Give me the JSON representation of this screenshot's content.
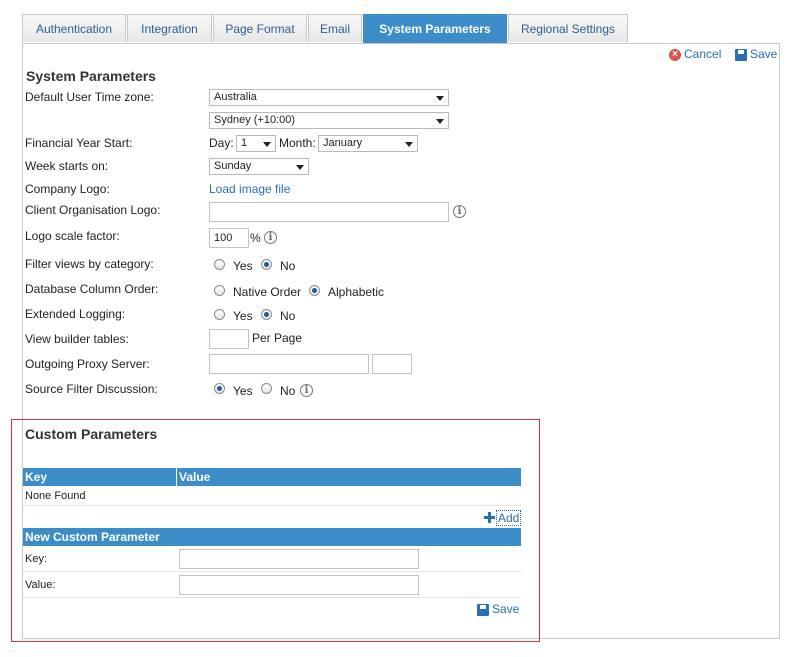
{
  "tabs": [
    {
      "label": "Authentication"
    },
    {
      "label": "Integration"
    },
    {
      "label": "Page Format"
    },
    {
      "label": "Email"
    },
    {
      "label": "System Parameters"
    },
    {
      "label": "Regional Settings"
    }
  ],
  "actions": {
    "cancel": "Cancel",
    "save": "Save"
  },
  "system": {
    "title": "System Parameters",
    "timezone": {
      "label": "Default User Time zone:",
      "region": "Australia",
      "city": "Sydney (+10:00)"
    },
    "financial": {
      "label": "Financial Year Start:",
      "day_label": "Day:",
      "day": "1",
      "month_label": "Month:",
      "month": "January"
    },
    "week": {
      "label": "Week starts on:",
      "value": "Sunday"
    },
    "company_logo": {
      "label": "Company Logo:",
      "link": "Load image file"
    },
    "client_logo": {
      "label": "Client Organisation Logo:",
      "value": ""
    },
    "logo_scale": {
      "label": "Logo scale factor:",
      "value": "100",
      "unit": "%"
    },
    "filter_views": {
      "label": "Filter views by category:",
      "yes": "Yes",
      "no": "No"
    },
    "db_order": {
      "label": "Database Column Order:",
      "native": "Native Order",
      "alpha": "Alphabetic"
    },
    "ext_logging": {
      "label": "Extended Logging:",
      "yes": "Yes",
      "no": "No"
    },
    "view_builder": {
      "label": "View builder tables:",
      "value": "",
      "suffix": "Per Page"
    },
    "proxy": {
      "label": "Outgoing Proxy Server:",
      "host": "",
      "port": ""
    },
    "source_filter": {
      "label": "Source Filter Discussion:",
      "yes": "Yes",
      "no": "No"
    }
  },
  "custom": {
    "title": "Custom Parameters",
    "col_key": "Key",
    "col_value": "Value",
    "empty": "None Found",
    "add": "Add",
    "new_title": "New Custom Parameter",
    "key_label": "Key:",
    "value_label": "Value:",
    "key_value": "",
    "value_value": "",
    "save": "Save"
  }
}
